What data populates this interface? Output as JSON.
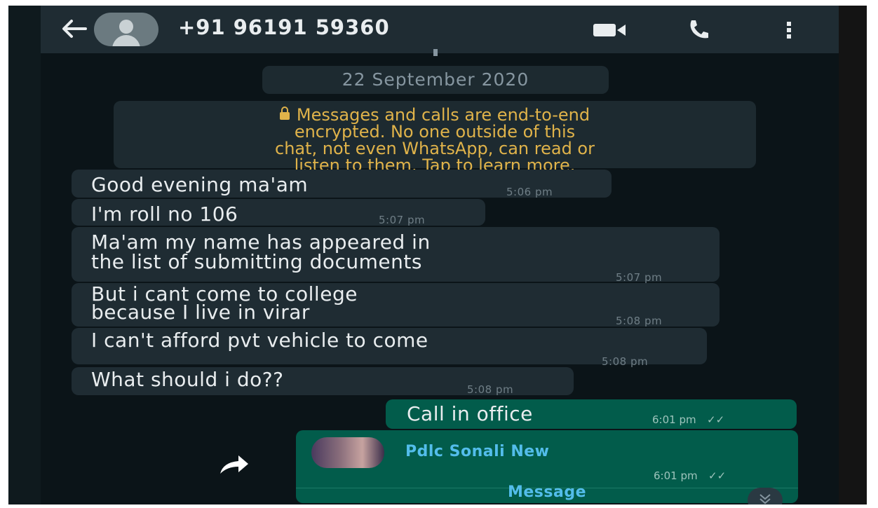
{
  "header": {
    "contact_name": "+91 96191 59360",
    "icons": [
      "back-arrow-icon",
      "avatar",
      "video-call-icon",
      "phone-icon",
      "more-vert-icon"
    ]
  },
  "chat": {
    "date_chip": "22 September 2020",
    "encryption_notice": {
      "line1": "Messages and calls are end-to-end",
      "line2": "encrypted. No one outside of this",
      "line3": "chat, not even WhatsApp, can read or",
      "line4": "listen to them. Tap to learn more."
    },
    "incoming": [
      {
        "lines": [
          "Good evening ma'am"
        ],
        "time": "5:06 pm"
      },
      {
        "lines": [
          "I'm roll no 106"
        ],
        "time": "5:07 pm"
      },
      {
        "lines": [
          "Ma'am my name has appeared in",
          "the list of submitting documents"
        ],
        "time": "5:07 pm"
      },
      {
        "lines": [
          "But i cant come to college",
          "because I live in virar"
        ],
        "time": "5:08 pm"
      },
      {
        "lines": [
          "I can't afford pvt vehicle to come"
        ],
        "time": "5:08 pm"
      },
      {
        "lines": [
          "What should i do??"
        ],
        "time": "5:08 pm"
      }
    ],
    "outgoing_text": {
      "text": "Call in office",
      "time": "6:01 pm",
      "ticks": "✓✓"
    },
    "outgoing_contact": {
      "name": "Pdlc Sonali New",
      "time": "6:01 pm",
      "ticks": "✓✓",
      "action": "Message"
    }
  },
  "colors": {
    "background": "#0b1418",
    "header": "#1f2c33",
    "incoming_bubble": "#1f2c33",
    "outgoing_bubble": "#025c4b",
    "notice_text": "#e0b34a",
    "link_blue": "#53bdeb"
  }
}
